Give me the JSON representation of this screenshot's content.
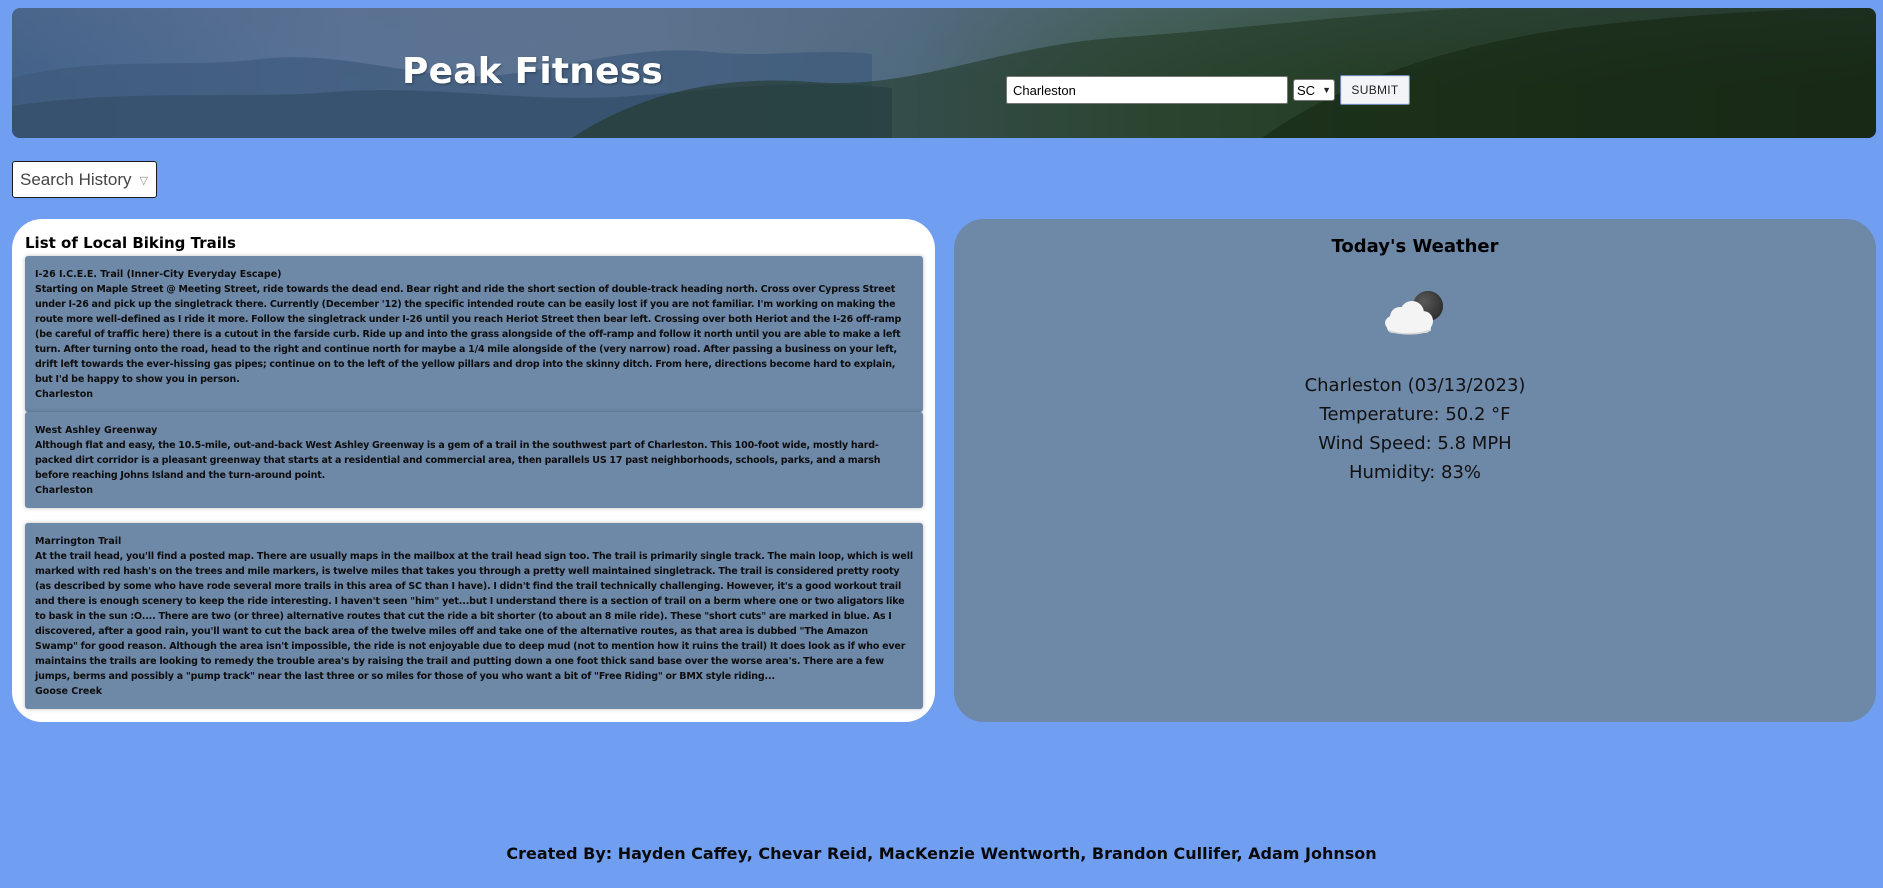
{
  "header": {
    "brand": "Peak Fitness"
  },
  "search": {
    "city_value": "Charleston",
    "state_value": "SC",
    "submit_label": "SUBMIT"
  },
  "history": {
    "label": "Search History"
  },
  "trails": {
    "title": "List of Local Biking Trails",
    "items": [
      {
        "name": "I-26 I.C.E.E. Trail (Inner-City Everyday Escape)",
        "description": "Starting on Maple Street @ Meeting Street, ride towards the dead end. Bear right and ride the short section of double-track heading north. Cross over Cypress Street under I-26 and pick up the singletrack there. Currently (December '12) the specific intended route can be easily lost if you are not familiar. I'm working on making the route more well-defined as I ride it more. Follow the singletrack under I-26 until you reach Heriot Street then bear left. Crossing over both Heriot and the I-26 off-ramp (be careful of traffic here) there is a cutout in the farside curb. Ride up and into the grass alongside of the off-ramp and follow it north until you are able to make a left turn. After turning onto the road, head to the right and continue north for maybe a 1/4 mile alongside of the (very narrow) road. After passing a business on your left, drift left towards the ever-hissing gas pipes; continue on to the left of the yellow pillars and drop into the skinny ditch. From here, directions become hard to explain, but I'd be happy to show you in person.",
        "location": "Charleston"
      },
      {
        "name": "West Ashley Greenway",
        "description": "Although flat and easy, the 10.5-mile, out-and-back West Ashley Greenway is a gem of a trail in the southwest part of Charleston. This 100-foot wide, mostly hard-packed dirt corridor is a pleasant greenway that starts at a residential and commercial area, then parallels US 17 past neighborhoods, schools, parks, and a marsh before reaching Johns Island and the turn-around point.",
        "location": "Charleston"
      },
      {
        "name": "Marrington Trail",
        "description": "At the trail head, you'll find a posted map. There are usually maps in the mailbox at the trail head sign too. The trail is primarily single track. The main loop, which is well marked with red hash's on the trees and mile markers, is twelve miles that takes you through a pretty well maintained singletrack. The trail is considered pretty rooty (as described by some who have rode several more trails in this area of SC than I have). I didn't find the trail technically challenging. However, it's a good workout trail and there is enough scenery to keep the ride interesting. I haven't seen \"him\" yet...but I understand there is a section of trail on a berm where one or two aligators like to bask in the sun :O.... There are two (or three) alternative routes that cut the ride a bit shorter (to about an 8 mile ride). These \"short cuts\" are marked in blue. As I discovered, after a good rain, you'll want to cut the back area of the twelve miles off and take one of the alternative routes, as that area is dubbed \"The Amazon Swamp\" for good reason. Although the area isn't impossible, the ride is not enjoyable due to deep mud (not to mention how it ruins the trail) It does look as if who ever maintains the trails are looking to remedy the trouble area's by raising the trail and putting down a one foot thick sand base over the worse area's. There are a few jumps, berms and possibly a \"pump track\" near the last three or so miles for those of you who want a bit of \"Free Riding\" or BMX style riding...",
        "location": "Goose Creek"
      }
    ]
  },
  "weather": {
    "title": "Today's Weather",
    "icon": "partly-cloudy-night-icon",
    "city_date": "Charleston (03/13/2023)",
    "temperature": "Temperature: 50.2 °F",
    "wind": "Wind Speed: 5.8 MPH",
    "humidity": "Humidity: 83%"
  },
  "footer": {
    "credits": "Created By: Hayden Caffey, Chevar Reid, MacKenzie Wentworth, Brandon Cullifer, Adam Johnson"
  },
  "colors": {
    "page_background": "#709ef1",
    "card_background": "#6e88a8",
    "panel_white": "#ffffff"
  }
}
